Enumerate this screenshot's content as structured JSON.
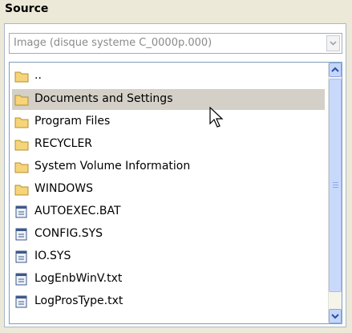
{
  "section": {
    "title": "Source"
  },
  "source_select": {
    "value": "Image (disque systeme C_0000p.000)"
  },
  "file_list": {
    "items": [
      {
        "label": "..",
        "type": "folder"
      },
      {
        "label": "Documents and Settings",
        "type": "folder",
        "selected": true
      },
      {
        "label": "Program Files",
        "type": "folder"
      },
      {
        "label": "RECYCLER",
        "type": "folder"
      },
      {
        "label": "System Volume Information",
        "type": "folder"
      },
      {
        "label": "WINDOWS",
        "type": "folder"
      },
      {
        "label": "AUTOEXEC.BAT",
        "type": "file"
      },
      {
        "label": "CONFIG.SYS",
        "type": "file"
      },
      {
        "label": "IO.SYS",
        "type": "file"
      },
      {
        "label": "LogEnbWinV.txt",
        "type": "file"
      },
      {
        "label": "LogProsType.txt",
        "type": "file"
      }
    ]
  },
  "colors": {
    "selection": "#d4d0c8",
    "folder": "#f6d47a",
    "accent": "#8aa8e8"
  }
}
